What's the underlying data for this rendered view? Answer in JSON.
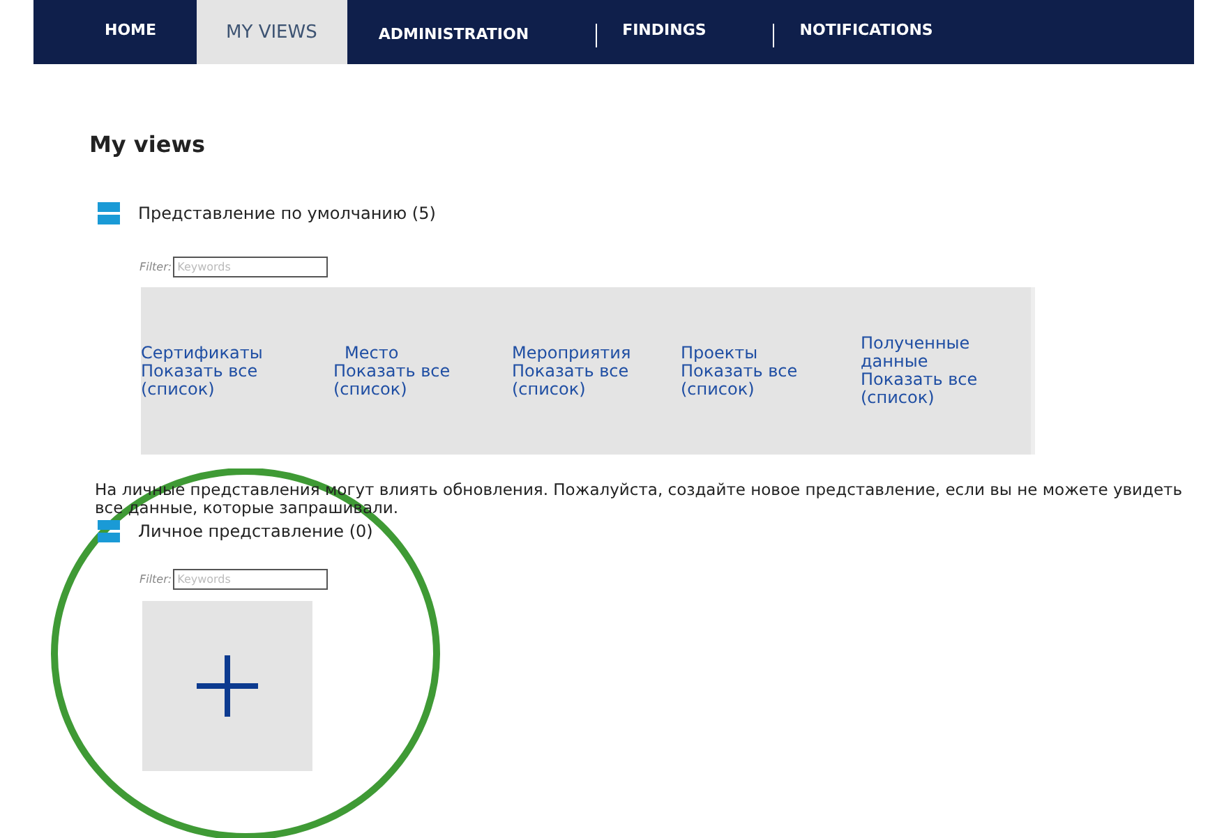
{
  "nav": {
    "tabs": [
      {
        "label": "HOME",
        "selected": false,
        "separator_before": false
      },
      {
        "label": "MY VIEWS",
        "selected": true,
        "separator_before": false
      },
      {
        "label": "ADMINISTRATION",
        "selected": false,
        "separator_before": false
      },
      {
        "label": "FINDINGS",
        "selected": false,
        "separator_before": true
      },
      {
        "label": "NOTIFICATIONS",
        "selected": false,
        "separator_before": true
      }
    ]
  },
  "heading": "My views",
  "default_view": {
    "title": "Представление по умолчанию (5)",
    "filter": {
      "label": "Filter:",
      "placeholder": "Keywords"
    },
    "columns": [
      {
        "title": "Сертификаты",
        "link": "Показать все (список)"
      },
      {
        "title": "Место",
        "link": "Показать все (список)"
      },
      {
        "title": "Мероприятия",
        "link": "Показать все (список)"
      },
      {
        "title": "Проекты",
        "link": "Показать все (список)"
      },
      {
        "title": "Полученные данные",
        "link": "Показать все (список)"
      }
    ]
  },
  "notice": "На личные представления могут влиять обновления. Пожалуйста, создайте новое представление, если вы не можете увидеть все данные, которые запрашивали.",
  "personal_view": {
    "title": "Личное представление (0)",
    "filter": {
      "label": "Filter:",
      "placeholder": "Keywords"
    },
    "add_tile": true
  }
}
